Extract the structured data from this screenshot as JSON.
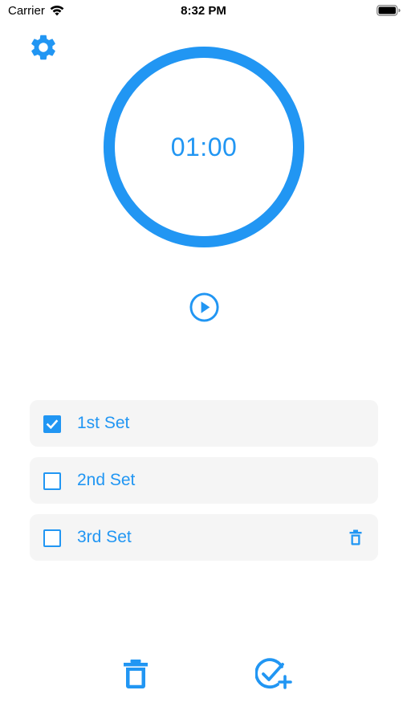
{
  "status_bar": {
    "carrier": "Carrier",
    "time": "8:32 PM"
  },
  "timer": {
    "display": "01:00",
    "progress": 1.0
  },
  "sets": [
    {
      "label": "1st Set",
      "checked": true,
      "deletable": false
    },
    {
      "label": "2nd Set",
      "checked": false,
      "deletable": false
    },
    {
      "label": "3rd Set",
      "checked": false,
      "deletable": true
    }
  ],
  "icons": {
    "settings": "gear-icon",
    "play": "play-circle-icon",
    "delete_row": "trash-icon",
    "delete_all": "trash-icon",
    "add_set": "check-circle-plus-icon"
  },
  "colors": {
    "accent": "#2196F3",
    "row_background": "#F5F5F5"
  }
}
